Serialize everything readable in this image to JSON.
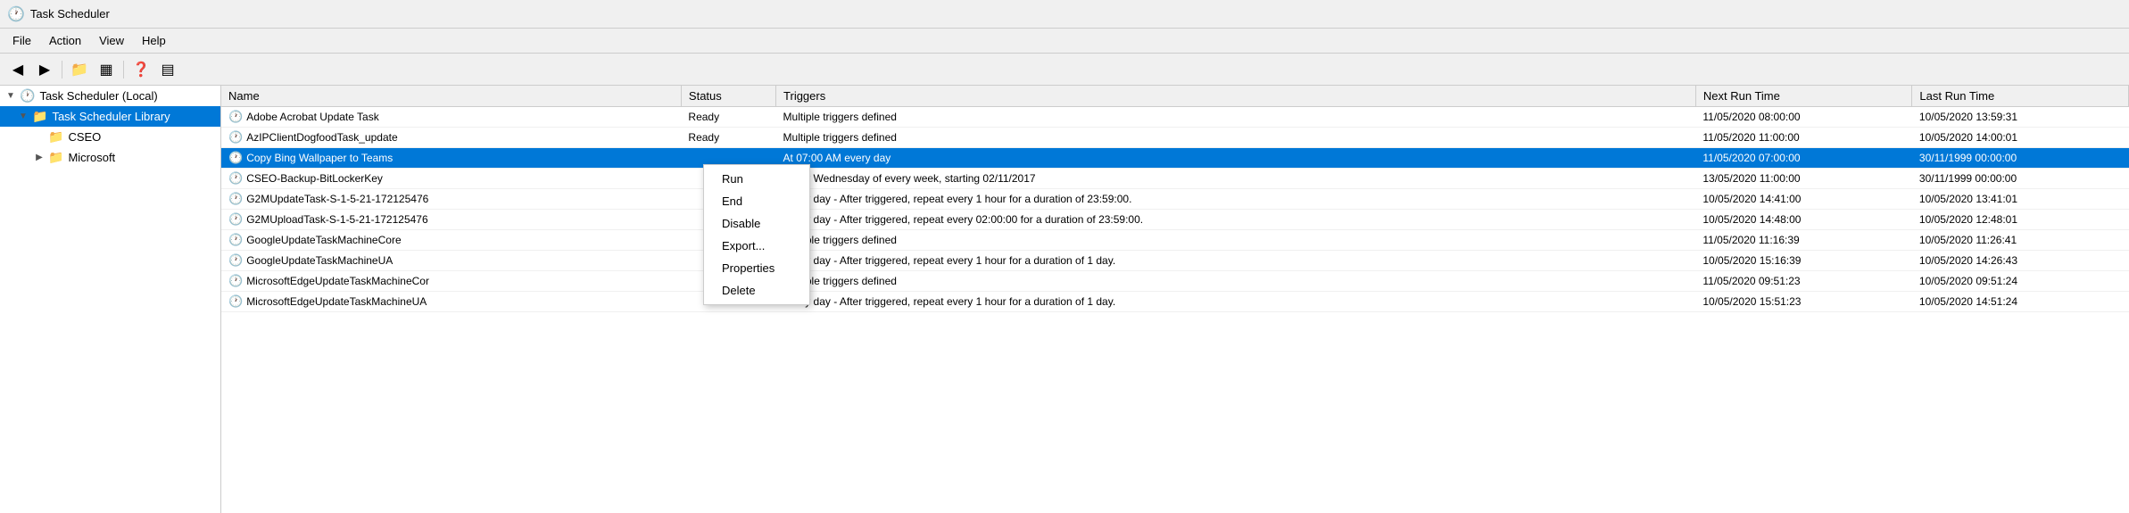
{
  "window": {
    "title": "Task Scheduler",
    "icon": "🕐"
  },
  "menubar": {
    "items": [
      {
        "label": "File"
      },
      {
        "label": "Action"
      },
      {
        "label": "View"
      },
      {
        "label": "Help"
      }
    ]
  },
  "toolbar": {
    "buttons": [
      {
        "icon": "◀",
        "label": "back-button"
      },
      {
        "icon": "▶",
        "label": "forward-button"
      },
      {
        "icon": "📁",
        "label": "folder-button"
      },
      {
        "icon": "▦",
        "label": "grid-button"
      },
      {
        "icon": "❓",
        "label": "help-button"
      },
      {
        "icon": "▤",
        "label": "view-button"
      }
    ]
  },
  "tree": {
    "items": [
      {
        "label": "Task Scheduler (Local)",
        "indent": 0,
        "arrow": "▼",
        "icon": "🕐",
        "selected": false
      },
      {
        "label": "Task Scheduler Library",
        "indent": 1,
        "arrow": "▼",
        "icon": "📁",
        "selected": true
      },
      {
        "label": "CSEO",
        "indent": 2,
        "arrow": "",
        "icon": "📁",
        "selected": false
      },
      {
        "label": "Microsoft",
        "indent": 2,
        "arrow": "▶",
        "icon": "📁",
        "selected": false
      }
    ]
  },
  "table": {
    "columns": [
      {
        "label": "Name"
      },
      {
        "label": "Status"
      },
      {
        "label": "Triggers"
      },
      {
        "label": "Next Run Time"
      },
      {
        "label": "Last Run Time"
      }
    ],
    "rows": [
      {
        "name": "Adobe Acrobat Update Task",
        "status": "Ready",
        "triggers": "Multiple triggers defined",
        "next_run": "11/05/2020 08:00:00",
        "last_run": "10/05/2020 13:59:31",
        "selected": false
      },
      {
        "name": "AzIPClientDogfoodTask_update",
        "status": "Ready",
        "triggers": "Multiple triggers defined",
        "next_run": "11/05/2020 11:00:00",
        "last_run": "10/05/2020 14:00:01",
        "selected": false
      },
      {
        "name": "Copy Bing Wallpaper to Teams",
        "status": "",
        "triggers": "At 07:00 AM every day",
        "next_run": "11/05/2020 07:00:00",
        "last_run": "30/11/1999 00:00:00",
        "selected": true
      },
      {
        "name": "CSEO-Backup-BitLockerKey",
        "status": "",
        "triggers": "Every Wednesday of every week, starting 02/11/2017",
        "next_run": "13/05/2020 11:00:00",
        "last_run": "30/11/1999 00:00:00",
        "selected": false
      },
      {
        "name": "G2MUpdateTask-S-1-5-21-172125476",
        "status": "",
        "triggers": "Every day - After triggered, repeat every 1 hour for a duration of 23:59:00.",
        "next_run": "10/05/2020 14:41:00",
        "last_run": "10/05/2020 13:41:01",
        "selected": false
      },
      {
        "name": "G2MUploadTask-S-1-5-21-172125476",
        "status": "",
        "triggers": "Every day - After triggered, repeat every 02:00:00 for a duration of 23:59:00.",
        "next_run": "10/05/2020 14:48:00",
        "last_run": "10/05/2020 12:48:01",
        "selected": false
      },
      {
        "name": "GoogleUpdateTaskMachineCore",
        "status": "",
        "triggers": "Multiple triggers defined",
        "next_run": "11/05/2020 11:16:39",
        "last_run": "10/05/2020 11:26:41",
        "selected": false
      },
      {
        "name": "GoogleUpdateTaskMachineUA",
        "status": "",
        "triggers": "Every day - After triggered, repeat every 1 hour for a duration of 1 day.",
        "next_run": "10/05/2020 15:16:39",
        "last_run": "10/05/2020 14:26:43",
        "selected": false
      },
      {
        "name": "MicrosoftEdgeUpdateTaskMachineCor",
        "status": "",
        "triggers": "Multiple triggers defined",
        "next_run": "11/05/2020 09:51:23",
        "last_run": "10/05/2020 09:51:24",
        "selected": false
      },
      {
        "name": "MicrosoftEdgeUpdateTaskMachineUA",
        "status": "",
        "triggers": "Every day - After triggered, repeat every 1 hour for a duration of 1 day.",
        "next_run": "10/05/2020 15:51:23",
        "last_run": "10/05/2020 14:51:24",
        "selected": false
      }
    ]
  },
  "context_menu": {
    "items": [
      {
        "label": "Run",
        "sep_after": false
      },
      {
        "label": "End",
        "sep_after": false
      },
      {
        "label": "Disable",
        "sep_after": false
      },
      {
        "label": "Export...",
        "sep_after": false
      },
      {
        "label": "Properties",
        "sep_after": false
      },
      {
        "label": "Delete",
        "sep_after": false
      }
    ]
  }
}
